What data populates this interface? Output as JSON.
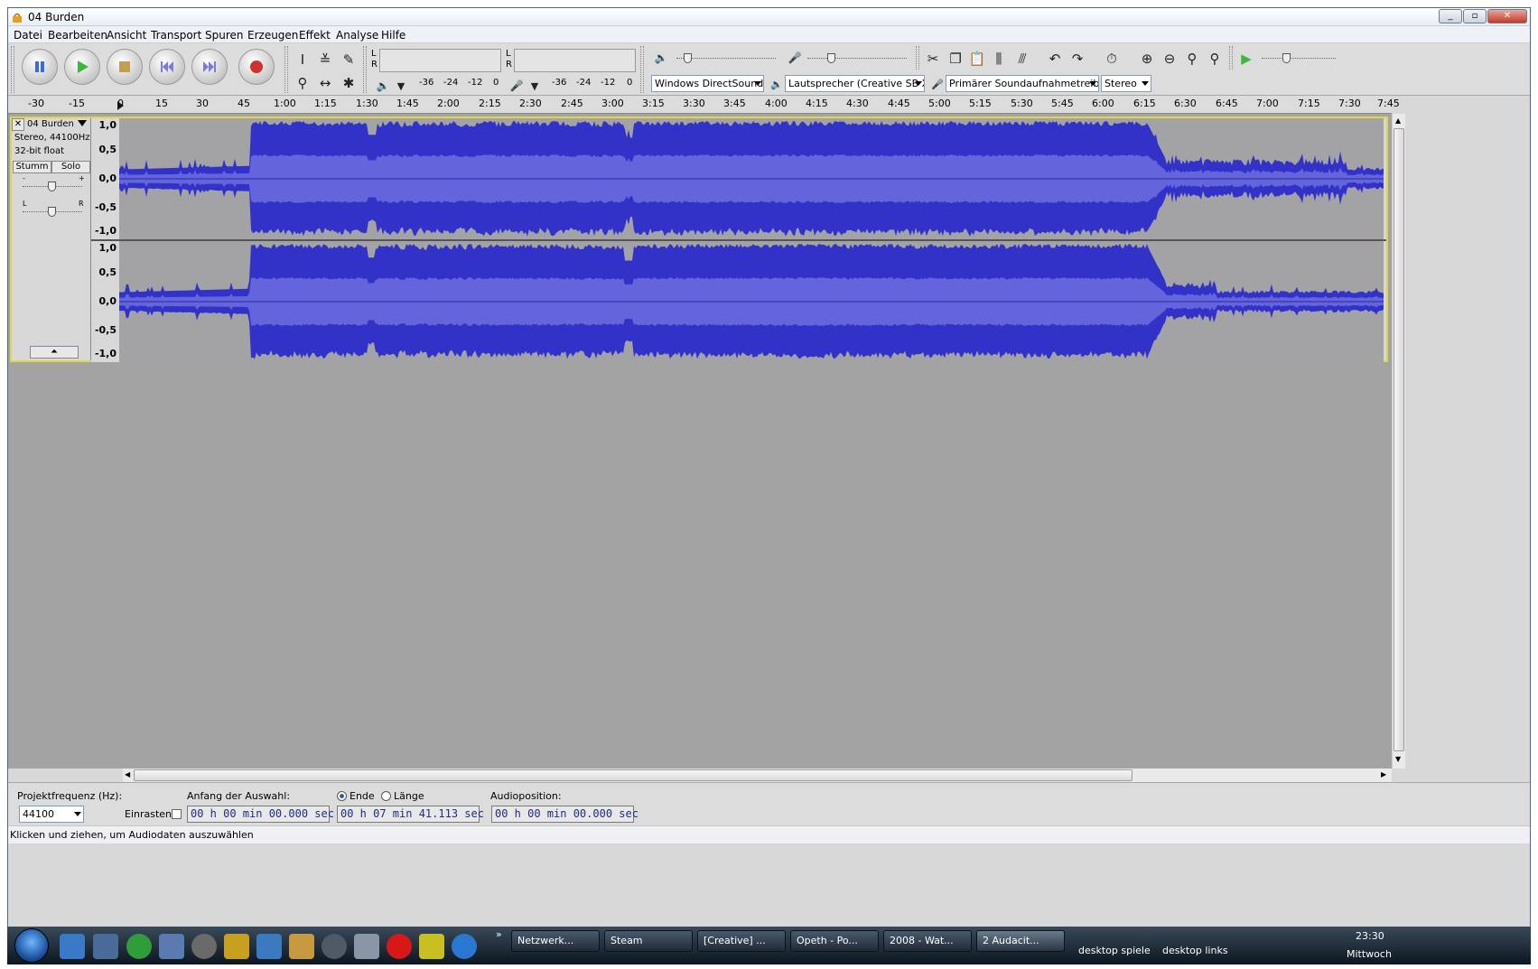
{
  "window": {
    "title": "04 Burden"
  },
  "menu": [
    "Datei",
    "Bearbeiten",
    "Ansicht",
    "Transport",
    "Spuren",
    "Erzeugen",
    "Effekt",
    "Analyse",
    "Hilfe"
  ],
  "meters": {
    "output_L": "L",
    "output_R": "R",
    "input_L": "L",
    "input_R": "R",
    "output_scale": [
      "-36",
      "-24",
      "-12",
      "0"
    ],
    "input_scale": [
      "-36",
      "-24",
      "-12",
      "0"
    ]
  },
  "device_toolbar": {
    "host": "Windows DirectSound",
    "output": "Lautsprecher (Creative SB X-F",
    "input": "Primärer Soundaufnahmetreiber",
    "channels": "Stereo"
  },
  "ruler_ticks": [
    "-30",
    "-15",
    "0",
    "15",
    "30",
    "45",
    "1:00",
    "1:15",
    "1:30",
    "1:45",
    "2:00",
    "2:15",
    "2:30",
    "2:45",
    "3:00",
    "3:15",
    "3:30",
    "3:45",
    "4:00",
    "4:15",
    "4:30",
    "4:45",
    "5:00",
    "5:15",
    "5:30",
    "5:45",
    "6:00",
    "6:15",
    "6:30",
    "6:45",
    "7:00",
    "7:15",
    "7:30",
    "7:45"
  ],
  "track": {
    "name": "04 Burden",
    "format": "Stereo, 44100Hz",
    "bitdepth": "32-bit float",
    "mute_label": "Stumm",
    "solo_label": "Solo",
    "gain_minus": "-",
    "gain_plus": "+",
    "pan_left": "L",
    "pan_right": "R",
    "scale": [
      "1,0",
      "0,5",
      "0,0",
      "-0,5",
      "-1,0"
    ]
  },
  "selection_bar": {
    "rate_label": "Projektfrequenz (Hz):",
    "rate_value": "44100",
    "snap_label": "Einrasten",
    "start_label": "Anfang der Auswahl:",
    "end_label": "Ende",
    "length_label": "Länge",
    "start_value": "00 h 00 min 00.000 sec",
    "end_value": "00 h 07 min 41.113 sec",
    "position_label": "Audioposition:",
    "position_value": "00 h 00 min 00.000 sec"
  },
  "status": "Klicken und ziehen, um Audiodaten auszuwählen",
  "taskbar": {
    "items": [
      "Netzwerk...",
      "Steam",
      "[Creative] ...",
      "Opeth - Po...",
      "2008 - Wat...",
      "2 Audacit..."
    ],
    "toolbar_labels": [
      "desktop spiele",
      "desktop links"
    ],
    "clock_time": "23:30",
    "clock_day": "Mittwoch"
  },
  "colors": {
    "waveform": "#3232c8",
    "waveform_rms": "#6464dc",
    "track_bg": "#a3a3a6",
    "selection_border": "#e3d44a"
  },
  "icons": {
    "pause": "pause-icon",
    "play": "play-icon",
    "stop": "stop-icon",
    "skip_start": "skip-to-start-icon",
    "skip_end": "skip-to-end-icon",
    "record": "record-icon"
  }
}
